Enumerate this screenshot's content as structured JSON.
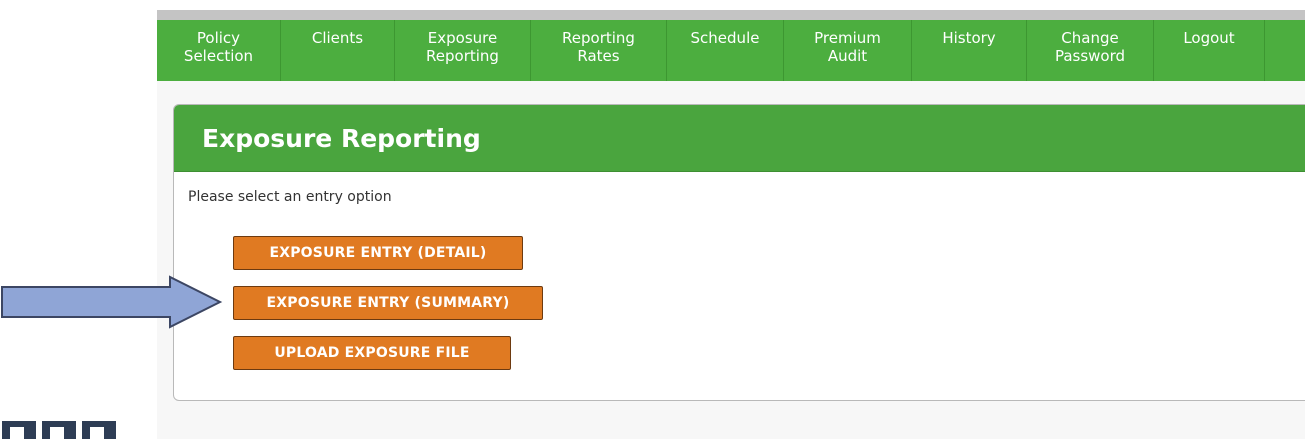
{
  "nav": {
    "items": [
      {
        "label": "Policy\nSelection",
        "width": 124
      },
      {
        "label": "Clients",
        "width": 114
      },
      {
        "label": "Exposure\nReporting",
        "width": 136
      },
      {
        "label": "Reporting\nRates",
        "width": 136
      },
      {
        "label": "Schedule",
        "width": 117
      },
      {
        "label": "Premium\nAudit",
        "width": 128
      },
      {
        "label": "History",
        "width": 115
      },
      {
        "label": "Change\nPassword",
        "width": 127
      },
      {
        "label": "Logout",
        "width": 111
      }
    ]
  },
  "panel": {
    "title": "Exposure Reporting",
    "instruction": "Please select an entry option"
  },
  "buttons": {
    "detail": "EXPOSURE ENTRY (DETAIL)",
    "summary": "EXPOSURE ENTRY (SUMMARY)",
    "upload": "UPLOAD EXPOSURE FILE"
  },
  "colors": {
    "nav_green": "#4cae3f",
    "button_orange": "#e07a22",
    "arrow_fill": "#8fa5d6",
    "arrow_stroke": "#3c4663"
  },
  "annotation": {
    "arrow_icon": "right-arrow-icon"
  }
}
